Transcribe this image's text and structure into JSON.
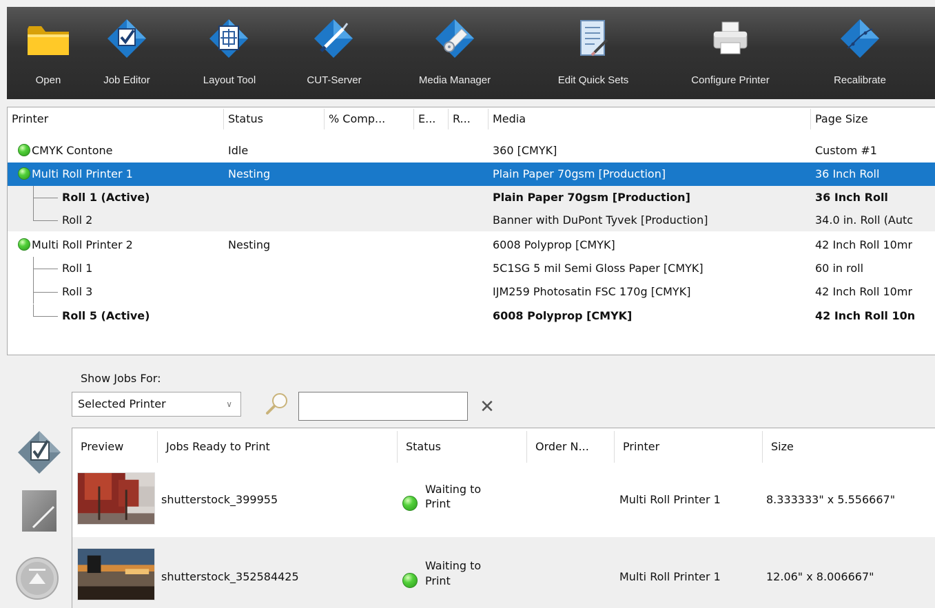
{
  "toolbar": {
    "items": [
      {
        "label": "Open",
        "icon": "folder-icon"
      },
      {
        "label": "Job Editor",
        "icon": "job-editor-icon"
      },
      {
        "label": "Layout Tool",
        "icon": "layout-tool-icon"
      },
      {
        "label": "CUT-Server",
        "icon": "cut-server-icon"
      },
      {
        "label": "Media Manager",
        "icon": "media-manager-icon"
      },
      {
        "label": "Edit Quick Sets",
        "icon": "edit-quick-sets-icon"
      },
      {
        "label": "Configure Printer",
        "icon": "printer-icon"
      },
      {
        "label": "Recalibrate",
        "icon": "recalibrate-icon"
      }
    ]
  },
  "printers": {
    "headers": {
      "printer": "Printer",
      "status": "Status",
      "complete": "% Comp...",
      "e": "E...",
      "r": "R...",
      "media": "Media",
      "page_size": "Page Size"
    },
    "rows": [
      {
        "name": "CMYK Contone",
        "status": "Idle",
        "media": "360 [CMYK]",
        "page_size": "Custom #1"
      },
      {
        "name": "Multi Roll Printer 1",
        "status": "Nesting",
        "media": "Plain Paper 70gsm [Production]",
        "page_size": "36 Inch Roll"
      },
      {
        "name": "Roll 1 (Active)",
        "status": "",
        "media": "Plain Paper 70gsm [Production]",
        "page_size": "36 Inch Roll"
      },
      {
        "name": "Roll 2",
        "status": "",
        "media": "Banner with DuPont Tyvek [Production]",
        "page_size": "34.0 in. Roll (Autc"
      },
      {
        "name": "Multi Roll Printer 2",
        "status": "Nesting",
        "media": "6008 Polyprop [CMYK]",
        "page_size": "42 Inch Roll 10mr"
      },
      {
        "name": "Roll 1",
        "status": "",
        "media": "5C1SG 5 mil Semi Gloss Paper [CMYK]",
        "page_size": "60 in roll"
      },
      {
        "name": "Roll 3",
        "status": "",
        "media": "IJM259 Photosatin FSC 170g [CMYK]",
        "page_size": "42 Inch Roll 10mr"
      },
      {
        "name": "Roll 5 (Active)",
        "status": "",
        "media": "6008 Polyprop [CMYK]",
        "page_size": "42 Inch Roll 10n"
      }
    ],
    "status_color": "#3cbf2a",
    "selection_color": "#1979ca"
  },
  "filter": {
    "show_jobs_for_label": "Show Jobs For:",
    "selected_value": "Selected Printer",
    "search_value": "",
    "clear_symbol": "✕"
  },
  "jobs": {
    "headers": {
      "preview": "Preview",
      "name": "Jobs Ready to Print",
      "status": "Status",
      "order": "Order N...",
      "printer": "Printer",
      "size": "Size"
    },
    "rows": [
      {
        "name": "shutterstock_399955",
        "status_line1": "Waiting to",
        "status_line2": "Print",
        "printer": "Multi Roll Printer 1",
        "size": "8.333333\" x 5.556667\""
      },
      {
        "name": "shutterstock_352584425",
        "status_line1": "Waiting to",
        "status_line2": "Print",
        "printer": "Multi Roll Printer 1",
        "size": "12.06\" x 8.006667\""
      }
    ]
  }
}
